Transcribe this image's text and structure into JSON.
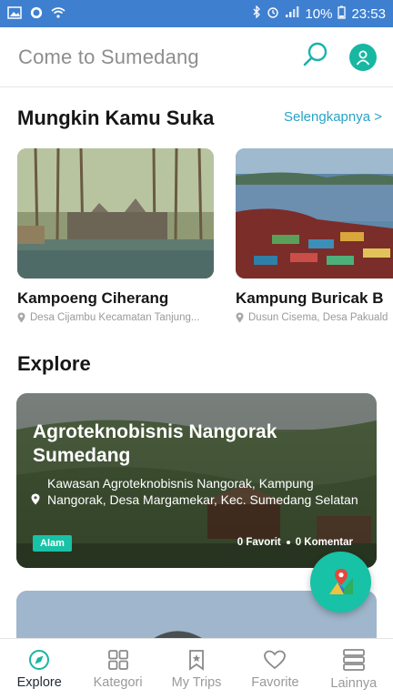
{
  "status_bar": {
    "battery": "10%",
    "time": "23:53"
  },
  "app_bar": {
    "title": "Come to Sumedang",
    "search_icon": "search-icon",
    "profile_icon": "user-icon"
  },
  "recommend": {
    "title": "Mungkin Kamu Suka",
    "see_more": "Selengkapnya >",
    "items": [
      {
        "name": "Kampoeng Ciherang",
        "location": "Desa Cijambu Kecamatan Tanjung..."
      },
      {
        "name": "Kampung Buricak B",
        "location": "Dusun Cisema, Desa Pakuald"
      }
    ]
  },
  "explore": {
    "title": "Explore",
    "items": [
      {
        "title": "Agroteknobisnis Nangorak Sumedang",
        "address": "Kawasan Agroteknobisnis Nangorak, Kampung Nangorak, Desa Margamekar, Kec. Sumedang Selatan",
        "category": "Alam",
        "favorites": "0 Favorit",
        "comments": "0 Komentar"
      }
    ]
  },
  "fab": {
    "icon": "map-icon"
  },
  "bottom_nav": {
    "items": [
      {
        "label": "Explore",
        "icon": "compass-icon",
        "active": true
      },
      {
        "label": "Kategori",
        "icon": "grid-icon",
        "active": false
      },
      {
        "label": "My Trips",
        "icon": "bookmark-icon",
        "active": false
      },
      {
        "label": "Favorite",
        "icon": "heart-icon",
        "active": false
      },
      {
        "label": "Lainnya",
        "icon": "menu-icon",
        "active": false
      }
    ]
  },
  "colors": {
    "status_bar": "#3f7fd0",
    "accent": "#17c2a6",
    "link": "#29a3c7"
  }
}
